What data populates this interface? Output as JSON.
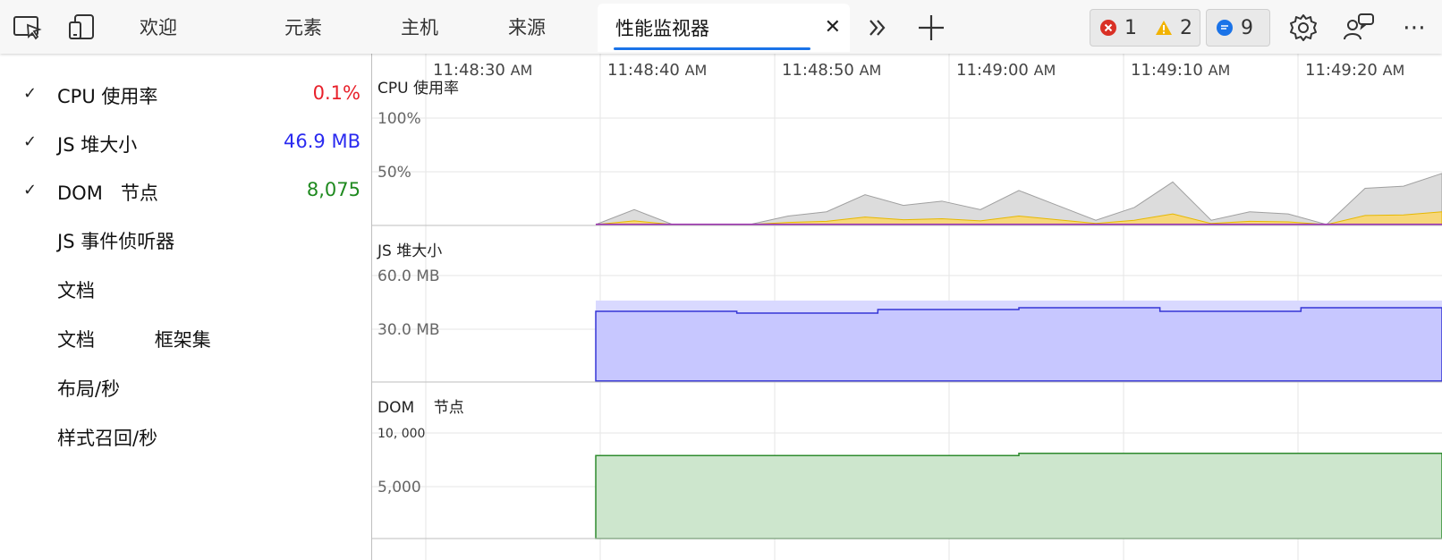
{
  "toolbar": {
    "tabs": [
      {
        "label": "欢迎"
      },
      {
        "label": "元素"
      },
      {
        "label": "主机"
      },
      {
        "label": "来源"
      },
      {
        "label": "性能监视器"
      }
    ],
    "close_label": "✕",
    "more_tabs_label": "»",
    "add_tab_label": "+",
    "issues": {
      "errors": "1",
      "warnings": "2",
      "messages": "9"
    },
    "more_label": "⋯"
  },
  "sidebar": {
    "metrics": [
      {
        "label": "CPU 使用率",
        "value": "0.1%",
        "checked": true,
        "color": "#e8202a"
      },
      {
        "label": "JS 堆大小",
        "value": "46.9 MB",
        "checked": true,
        "color": "#2a2af0"
      },
      {
        "label": "DOM   节点",
        "value": "8,075",
        "checked": true,
        "color": "#1f8a1f"
      },
      {
        "label": "JS 事件侦听器",
        "value": "",
        "checked": false
      },
      {
        "label": "文档",
        "value": "",
        "checked": false
      },
      {
        "label": "文档          框架集",
        "value": "",
        "checked": false
      },
      {
        "label": "布局/秒",
        "value": "",
        "checked": false
      },
      {
        "label": "样式召回/秒",
        "value": "",
        "checked": false
      }
    ]
  },
  "timeline": {
    "labels": [
      {
        "time": "11:48:30",
        "ampm": "AM"
      },
      {
        "time": "11:48:40",
        "ampm": "AM"
      },
      {
        "time": "11:48:50",
        "ampm": "AM"
      },
      {
        "time": "11:49:00",
        "ampm": "AM"
      },
      {
        "time": "11:49:10",
        "ampm": "AM"
      },
      {
        "time": "11:49:20",
        "ampm": "AM"
      }
    ]
  },
  "charts": {
    "cpu": {
      "title": "CPU 使用率",
      "ticks": [
        "100%",
        "50%"
      ]
    },
    "heap": {
      "title": "JS 堆大小",
      "ticks": [
        "60.0 MB",
        "30.0 MB"
      ]
    },
    "dom": {
      "title": "DOM    节点",
      "ticks": [
        "10, 000",
        "5,000"
      ]
    }
  },
  "chart_data": [
    {
      "type": "area",
      "title": "CPU 使用率",
      "x": [
        "11:48:40",
        "11:48:42",
        "11:48:44",
        "11:48:46",
        "11:48:48",
        "11:48:50",
        "11:48:52",
        "11:48:54",
        "11:48:56",
        "11:48:58",
        "11:49:00",
        "11:49:02",
        "11:49:04",
        "11:49:06",
        "11:49:08",
        "11:49:10",
        "11:49:12",
        "11:49:14",
        "11:49:16",
        "11:49:18",
        "11:49:20",
        "11:49:22",
        "11:49:24"
      ],
      "series": [
        {
          "values": [
            0,
            14,
            0,
            0,
            0,
            8,
            12,
            28,
            18,
            22,
            14,
            32,
            18,
            4,
            16,
            40,
            4,
            12,
            10,
            0,
            34,
            36,
            48
          ]
        }
      ],
      "ylim": [
        0,
        100
      ]
    },
    {
      "type": "area",
      "title": "JS 堆大小",
      "x": [
        "11:48:40",
        "11:48:50",
        "11:49:00",
        "11:49:05",
        "11:49:10",
        "11:49:20",
        "11:49:24"
      ],
      "series": [
        {
          "values": [
            40,
            39,
            41,
            42,
            40,
            42,
            39
          ]
        }
      ],
      "ylim": [
        0,
        70
      ]
    },
    {
      "type": "area",
      "title": "DOM    节点",
      "x": [
        "11:48:40",
        "11:49:00",
        "11:49:05",
        "11:49:20",
        "11:49:24"
      ],
      "series": [
        {
          "values": [
            7900,
            7900,
            8100,
            8100,
            7950
          ]
        }
      ],
      "ylim": [
        0,
        11000
      ]
    }
  ]
}
